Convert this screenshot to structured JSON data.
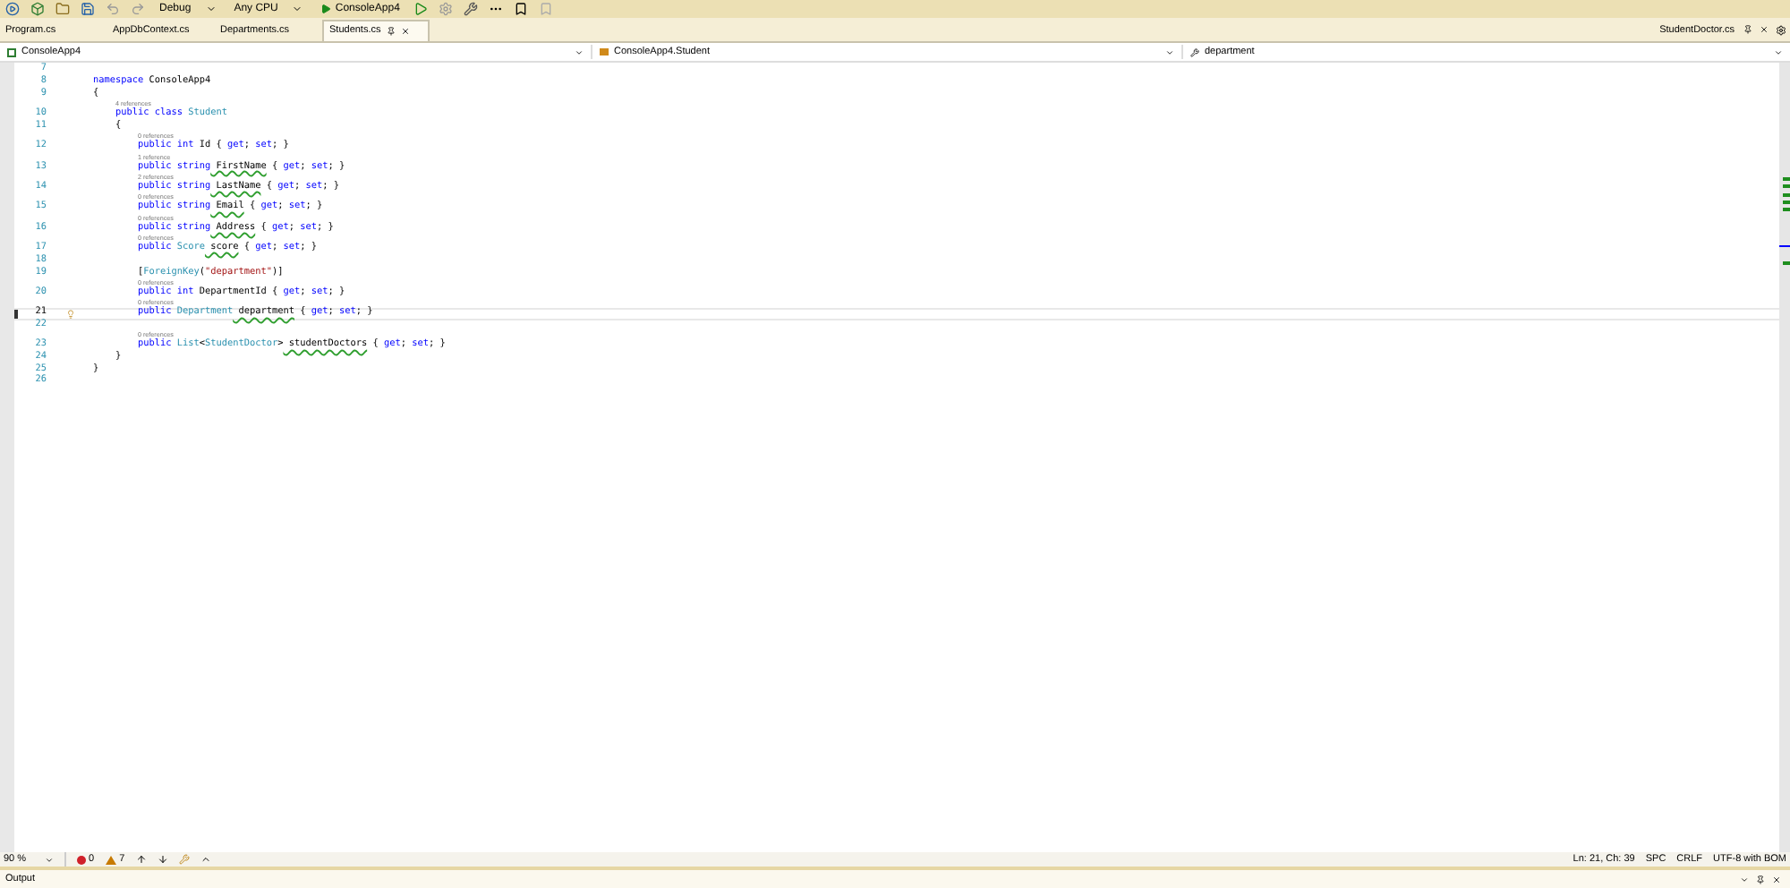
{
  "toolbar": {
    "configuration": "Debug",
    "platform": "Any CPU",
    "start": "ConsoleApp4"
  },
  "tabs": [
    {
      "label": "Program.cs",
      "selected": false
    },
    {
      "label": "AppDbContext.cs",
      "selected": false
    },
    {
      "label": "Departments.cs",
      "selected": false
    },
    {
      "label": "Students.cs",
      "selected": true
    }
  ],
  "preview_tab": {
    "label": "StudentDoctor.cs"
  },
  "navigation": {
    "project": "ConsoleApp4",
    "type": "ConsoleApp4.Student",
    "member": "department"
  },
  "lines": [
    {
      "number": "7",
      "current": false
    },
    {
      "number": "8",
      "current": false,
      "tokens": [
        {
          "kind": "keyword",
          "text": "namespace"
        },
        {
          "kind": "plain",
          "text": " ConsoleApp4"
        }
      ]
    },
    {
      "number": "9",
      "current": false,
      "tokens": [
        {
          "kind": "plain",
          "text": "{"
        }
      ]
    },
    {
      "number": "10",
      "current": false,
      "lens": "4 references",
      "tokens": [
        {
          "kind": "keyword",
          "text": "    public class"
        },
        {
          "kind": "type",
          "text": " Student"
        }
      ]
    },
    {
      "number": "11",
      "current": false,
      "tokens": [
        {
          "kind": "plain",
          "text": "    {"
        }
      ]
    },
    {
      "number": "12",
      "current": false,
      "lens": "0 references",
      "tokens": [
        {
          "kind": "keyword",
          "text": "        public int"
        },
        {
          "kind": "plain",
          "text": " Id { "
        },
        {
          "kind": "keyword",
          "text": "get"
        },
        {
          "kind": "plain",
          "text": "; "
        },
        {
          "kind": "keyword",
          "text": "set"
        },
        {
          "kind": "plain",
          "text": "; }"
        }
      ]
    },
    {
      "number": "13",
      "current": false,
      "lens": "1 reference",
      "tokens": [
        {
          "kind": "keyword",
          "text": "        public string"
        },
        {
          "kind": "warning",
          "text": " FirstName"
        },
        {
          "kind": "plain",
          "text": " { "
        },
        {
          "kind": "keyword",
          "text": "get"
        },
        {
          "kind": "plain",
          "text": "; "
        },
        {
          "kind": "keyword",
          "text": "set"
        },
        {
          "kind": "plain",
          "text": "; }"
        }
      ]
    },
    {
      "number": "14",
      "current": false,
      "lens": "2 references",
      "tokens": [
        {
          "kind": "keyword",
          "text": "        public string"
        },
        {
          "kind": "warning",
          "text": " LastName"
        },
        {
          "kind": "plain",
          "text": " { "
        },
        {
          "kind": "keyword",
          "text": "get"
        },
        {
          "kind": "plain",
          "text": "; "
        },
        {
          "kind": "keyword",
          "text": "set"
        },
        {
          "kind": "plain",
          "text": "; }"
        }
      ]
    },
    {
      "number": "15",
      "current": false,
      "lens": "0 references",
      "tokens": [
        {
          "kind": "keyword",
          "text": "        public string"
        },
        {
          "kind": "warning",
          "text": " Email"
        },
        {
          "kind": "plain",
          "text": " { "
        },
        {
          "kind": "keyword",
          "text": "get"
        },
        {
          "kind": "plain",
          "text": "; "
        },
        {
          "kind": "keyword",
          "text": "set"
        },
        {
          "kind": "plain",
          "text": "; }"
        }
      ]
    },
    {
      "number": "16",
      "current": false,
      "lens": "0 references",
      "tokens": [
        {
          "kind": "keyword",
          "text": "        public string"
        },
        {
          "kind": "warning",
          "text": " Address"
        },
        {
          "kind": "plain",
          "text": " { "
        },
        {
          "kind": "keyword",
          "text": "get"
        },
        {
          "kind": "plain",
          "text": "; "
        },
        {
          "kind": "keyword",
          "text": "set"
        },
        {
          "kind": "plain",
          "text": "; }"
        }
      ]
    },
    {
      "number": "17",
      "current": false,
      "lens": "0 references",
      "tokens": [
        {
          "kind": "keyword",
          "text": "        public"
        },
        {
          "kind": "type",
          "text": " Score"
        },
        {
          "kind": "warning",
          "text": " score"
        },
        {
          "kind": "plain",
          "text": " { "
        },
        {
          "kind": "keyword",
          "text": "get"
        },
        {
          "kind": "plain",
          "text": "; "
        },
        {
          "kind": "keyword",
          "text": "set"
        },
        {
          "kind": "plain",
          "text": "; }"
        }
      ]
    },
    {
      "number": "18",
      "current": false
    },
    {
      "number": "19",
      "current": false,
      "tokens": [
        {
          "kind": "plain",
          "text": "        ["
        },
        {
          "kind": "type",
          "text": "ForeignKey"
        },
        {
          "kind": "plain",
          "text": "("
        },
        {
          "kind": "string",
          "text": "\"department\""
        },
        {
          "kind": "plain",
          "text": ")]"
        }
      ]
    },
    {
      "number": "20",
      "current": false,
      "lens": "0 references",
      "tokens": [
        {
          "kind": "keyword",
          "text": "        public int"
        },
        {
          "kind": "plain",
          "text": " DepartmentId { "
        },
        {
          "kind": "keyword",
          "text": "get"
        },
        {
          "kind": "plain",
          "text": "; "
        },
        {
          "kind": "keyword",
          "text": "set"
        },
        {
          "kind": "plain",
          "text": "; }"
        }
      ]
    },
    {
      "number": "21",
      "current": true,
      "lens": "0 references",
      "tokens": [
        {
          "kind": "keyword",
          "text": "        public"
        },
        {
          "kind": "type",
          "text": " Department"
        },
        {
          "kind": "warning",
          "text": " department"
        },
        {
          "kind": "plain",
          "text": " { "
        },
        {
          "kind": "keyword",
          "text": "get"
        },
        {
          "kind": "plain",
          "text": "; "
        },
        {
          "kind": "keyword",
          "text": "set"
        },
        {
          "kind": "plain",
          "text": "; }"
        }
      ]
    },
    {
      "number": "22",
      "current": false
    },
    {
      "number": "23",
      "current": false,
      "lens": "0 references",
      "tokens": [
        {
          "kind": "keyword",
          "text": "        public"
        },
        {
          "kind": "type",
          "text": " List"
        },
        {
          "kind": "plain",
          "text": "<"
        },
        {
          "kind": "type",
          "text": "StudentDoctor"
        },
        {
          "kind": "plain",
          "text": ">"
        },
        {
          "kind": "warning",
          "text": " studentDoctors"
        },
        {
          "kind": "plain",
          "text": " { "
        },
        {
          "kind": "keyword",
          "text": "get"
        },
        {
          "kind": "plain",
          "text": "; "
        },
        {
          "kind": "keyword",
          "text": "set"
        },
        {
          "kind": "plain",
          "text": "; }"
        }
      ]
    },
    {
      "number": "24",
      "current": false,
      "tokens": [
        {
          "kind": "plain",
          "text": "    }"
        }
      ]
    },
    {
      "number": "25",
      "current": false,
      "tokens": [
        {
          "kind": "plain",
          "text": "}"
        }
      ]
    },
    {
      "number": "26",
      "current": false
    }
  ],
  "status": {
    "zoom": "90 %",
    "errors": "0",
    "warnings": "7",
    "position": "Ln: 21, Ch: 39",
    "whitespace": "SPC",
    "line_ending": "CRLF",
    "encoding": "UTF-8 with BOM"
  },
  "output_panel": {
    "title": "Output"
  }
}
